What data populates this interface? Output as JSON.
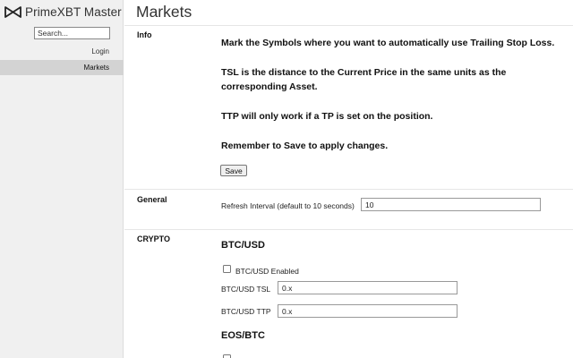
{
  "app": {
    "title": "PrimeXBT Master"
  },
  "sidebar": {
    "search_placeholder": "Search...",
    "items": [
      {
        "label": "Login"
      },
      {
        "label": "Markets"
      }
    ]
  },
  "page": {
    "title": "Markets"
  },
  "info": {
    "label": "Info",
    "lines": [
      "Mark the Symbols where you want to automatically use Trailing Stop Loss.",
      "TSL is the distance to the Current Price in the same units as the corresponding Asset.",
      "TTP will only work if a TP is set on the position.",
      "Remember to Save to apply changes."
    ],
    "save_label": "Save"
  },
  "general": {
    "label": "General",
    "refresh_label": "Refresh Interval (default to 10 seconds)",
    "refresh_value": "10"
  },
  "crypto": {
    "label": "CRYPTO",
    "assets": [
      {
        "title": "BTC/USD",
        "enabled_label": "BTC/USD Enabled",
        "enabled": false,
        "tsl_label": "BTC/USD TSL",
        "tsl_value": "0.x",
        "ttp_label": "BTC/USD TTP",
        "ttp_value": "0.x"
      },
      {
        "title": "EOS/BTC"
      }
    ]
  },
  "colors": {
    "sidebar_bg": "#f0f0f0",
    "sidebar_active_bg": "#d3d3d3"
  }
}
